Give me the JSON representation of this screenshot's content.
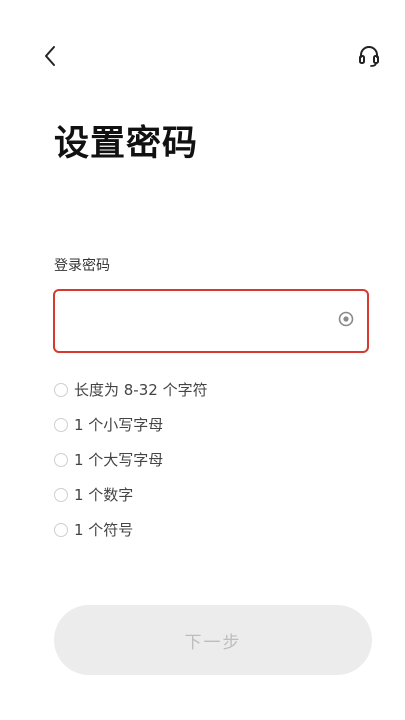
{
  "header": {
    "back_icon": "chevron-left-icon",
    "support_icon": "headset-icon"
  },
  "page": {
    "title": "设置密码"
  },
  "password_field": {
    "label": "登录密码",
    "value": "",
    "placeholder": "",
    "toggle_icon": "eye-icon"
  },
  "rules": [
    {
      "text": "长度为 8-32 个字符",
      "met": false
    },
    {
      "text": "1 个小写字母",
      "met": false
    },
    {
      "text": "1 个大写字母",
      "met": false
    },
    {
      "text": "1 个数字",
      "met": false
    },
    {
      "text": "1 个符号",
      "met": false
    }
  ],
  "next_button": {
    "label": "下一步",
    "enabled": false
  },
  "colors": {
    "accent_error": "#d63a2f",
    "button_disabled_bg": "#ececec",
    "button_disabled_text": "#bdbdbd",
    "title_text": "#111111"
  }
}
